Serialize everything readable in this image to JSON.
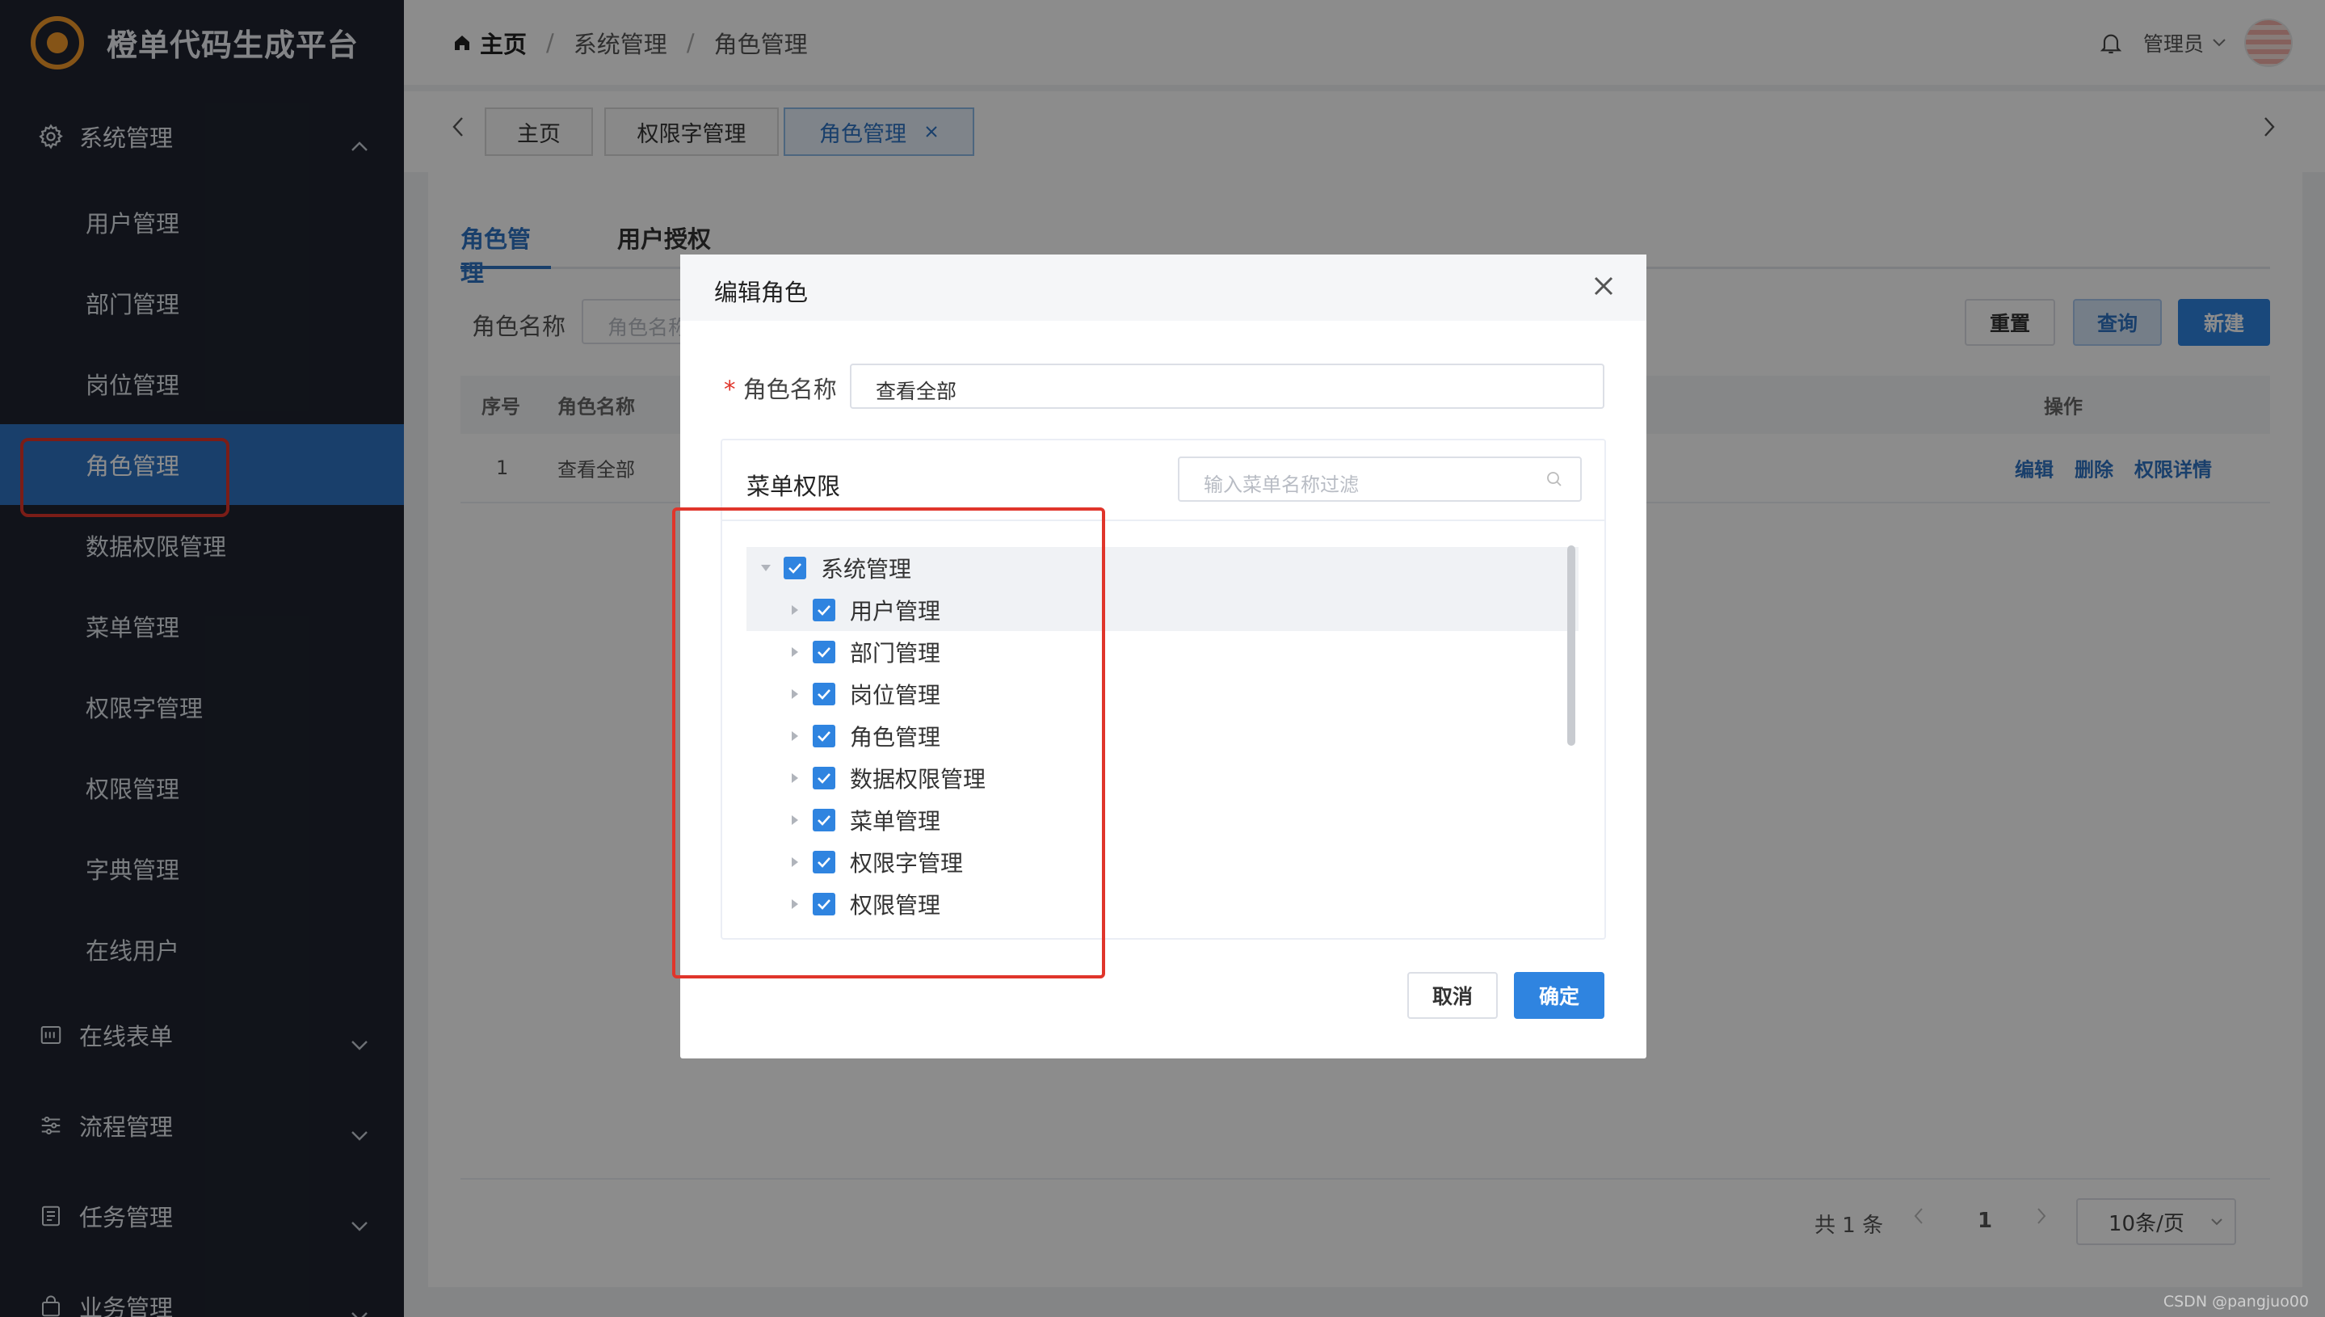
{
  "app": {
    "title": "橙单代码生成平台"
  },
  "sidebar": {
    "group_open": {
      "label": "系统管理",
      "icon": "gear-icon"
    },
    "items": [
      {
        "label": "用户管理"
      },
      {
        "label": "部门管理"
      },
      {
        "label": "岗位管理"
      },
      {
        "label": "角色管理",
        "active": true
      },
      {
        "label": "数据权限管理"
      },
      {
        "label": "菜单管理"
      },
      {
        "label": "权限字管理"
      },
      {
        "label": "权限管理"
      },
      {
        "label": "字典管理"
      },
      {
        "label": "在线用户"
      }
    ],
    "groups": [
      {
        "label": "在线表单",
        "icon": "form-icon"
      },
      {
        "label": "流程管理",
        "icon": "sliders-icon"
      },
      {
        "label": "任务管理",
        "icon": "task-icon"
      },
      {
        "label": "业务管理",
        "icon": "bag-icon"
      }
    ]
  },
  "header": {
    "breadcrumb": [
      "主页",
      "系统管理",
      "角色管理"
    ],
    "user": "管理员"
  },
  "tags": [
    {
      "label": "主页"
    },
    {
      "label": "权限字管理"
    },
    {
      "label": "角色管理",
      "active": true
    }
  ],
  "page": {
    "tabs": [
      "角色管理",
      "用户授权"
    ],
    "filter_label": "角色名称",
    "filter_placeholder": "角色名称",
    "buttons": {
      "reset": "重置",
      "query": "查询",
      "create": "新建"
    },
    "table": {
      "columns": [
        "序号",
        "角色名称",
        "操作"
      ],
      "rows": [
        {
          "index": "1",
          "name": "查看全部",
          "actions": [
            "编辑",
            "删除",
            "权限详情"
          ]
        }
      ]
    },
    "pagination": {
      "total_text": "共 1 条",
      "current": "1",
      "page_size": "10条/页"
    }
  },
  "dialog": {
    "title": "编辑角色",
    "role_label": "角色名称",
    "role_value": "查看全部",
    "perm_title": "菜单权限",
    "perm_search_placeholder": "输入菜单名称过滤",
    "tree": {
      "root": "系统管理",
      "children": [
        "用户管理",
        "部门管理",
        "岗位管理",
        "角色管理",
        "数据权限管理",
        "菜单管理",
        "权限字管理",
        "权限管理"
      ]
    },
    "cancel": "取消",
    "confirm": "确定"
  },
  "watermark": "CSDN @pangjuo00",
  "colors": {
    "accent": "#2f73c4",
    "sidebar_bg": "#1f2430",
    "highlight": "#e0352b",
    "brand": "#f39a2b"
  }
}
